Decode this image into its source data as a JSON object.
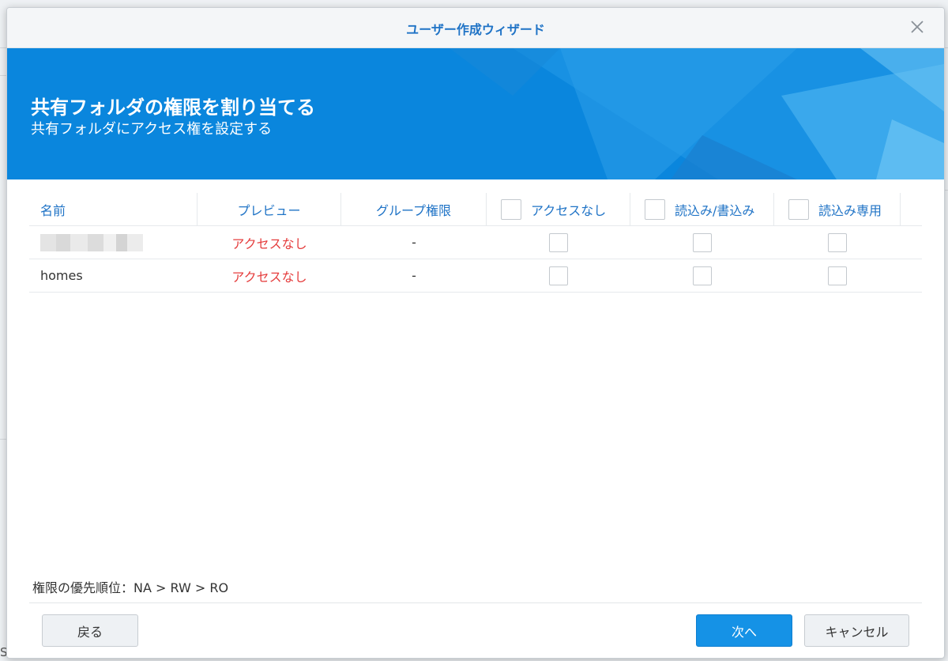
{
  "dialog": {
    "title": "ユーザー作成ウィザード",
    "close_symbol": "✕"
  },
  "banner": {
    "title": "共有フォルダの権限を割り当てる",
    "subtitle": "共有フォルダにアクセス権を設定する"
  },
  "table": {
    "headers": {
      "name": "名前",
      "preview": "プレビュー",
      "group_permission": "グループ権限",
      "no_access": "アクセスなし",
      "read_write": "読込み/書込み",
      "read_only": "読込み専用"
    },
    "rows": [
      {
        "name": "",
        "name_blurred": true,
        "preview": "アクセスなし",
        "group_permission": "-",
        "no_access": false,
        "read_write": false,
        "read_only": false
      },
      {
        "name": "homes",
        "name_blurred": false,
        "preview": "アクセスなし",
        "group_permission": "-",
        "no_access": false,
        "read_write": false,
        "read_only": false
      }
    ]
  },
  "priority_note": "権限の優先順位：NA > RW > RO",
  "buttons": {
    "back": "戻る",
    "next": "次へ",
    "cancel": "キャンセル"
  },
  "colors": {
    "accent": "#1f73c6",
    "banner": "#0a86dd",
    "primary_button": "#1592e6",
    "no_access_text": "#e53d3d"
  },
  "background_fragments": [
    "Server"
  ]
}
